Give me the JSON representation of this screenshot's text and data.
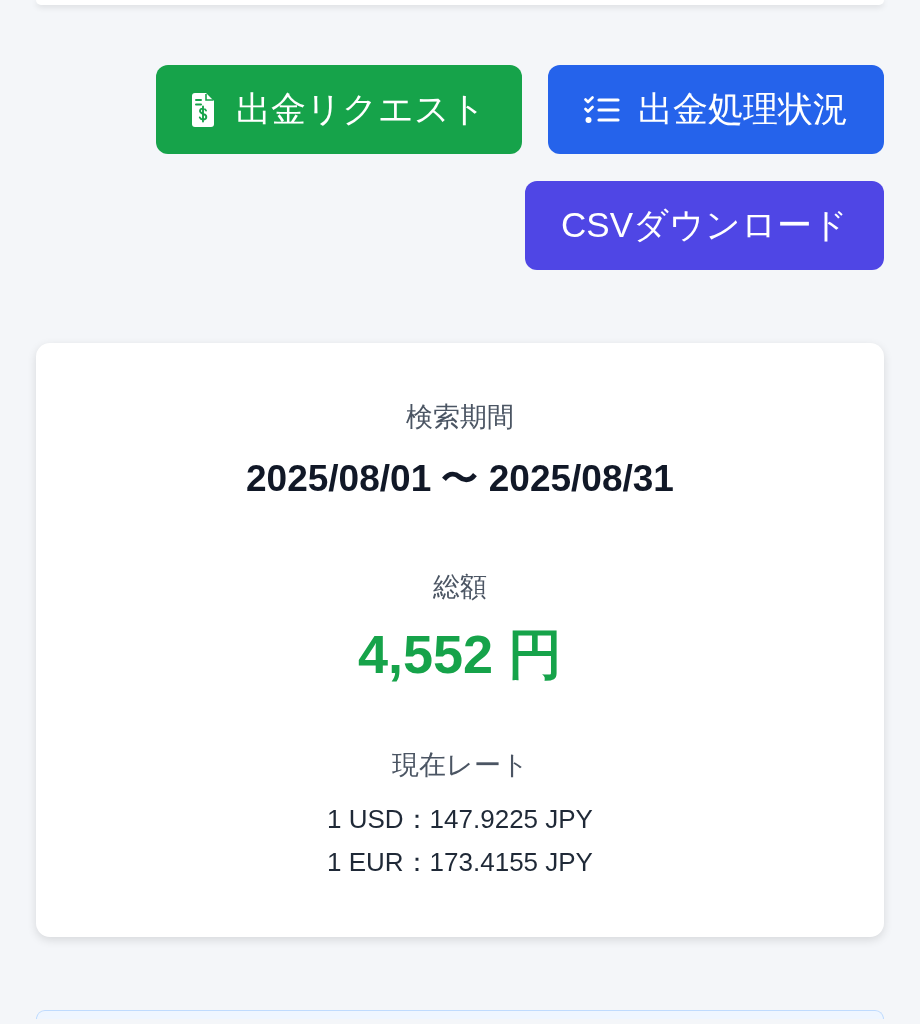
{
  "actions": [
    {
      "kind": "request",
      "label": "出金リクエスト"
    },
    {
      "kind": "status",
      "label": "出金処理状況"
    },
    {
      "kind": "csv",
      "label": "CSVダウンロード"
    }
  ],
  "summary": {
    "period_label": "検索期間",
    "period": "2025/08/01 〜 2025/08/31",
    "total_label": "総額",
    "total": "4,552 円",
    "rate_label": "現在レート",
    "rates": [
      "1 USD：147.9225 JPY",
      "1 EUR：173.4155 JPY"
    ]
  }
}
